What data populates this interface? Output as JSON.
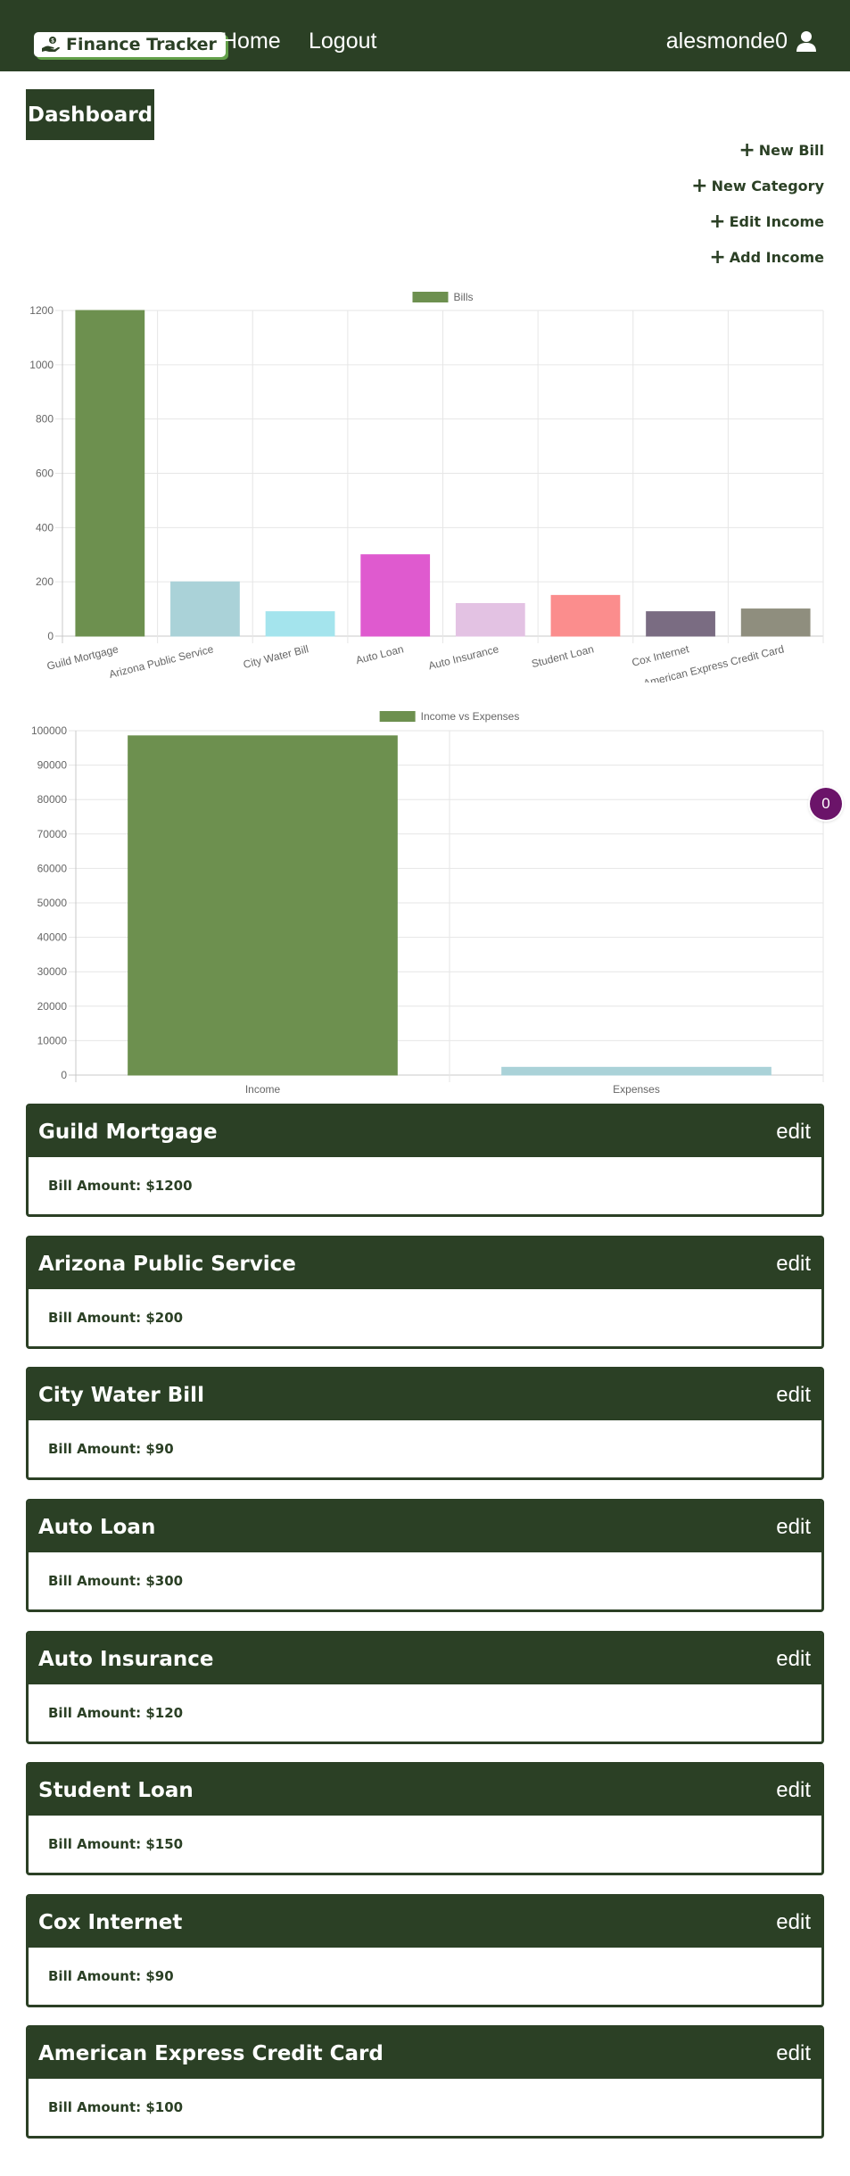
{
  "navbar": {
    "brand": "Finance Tracker",
    "brand_icon": "hand-holding-dollar-icon",
    "links": [
      "Home",
      "Logout"
    ],
    "username": "alesmonde0",
    "user_icon": "user-icon"
  },
  "page": {
    "title": "Dashboard"
  },
  "actions": [
    {
      "label": "New Bill",
      "icon": "plus-icon"
    },
    {
      "label": "New Category",
      "icon": "plus-icon"
    },
    {
      "label": "Edit Income",
      "icon": "plus-icon"
    },
    {
      "label": "Add Income",
      "icon": "plus-icon"
    }
  ],
  "notification_badge": "0",
  "chart_data": [
    {
      "type": "bar",
      "legend": "Bills",
      "categories": [
        "Guild Mortgage",
        "Arizona Public Service",
        "City Water Bill",
        "Auto Loan",
        "Auto Insurance",
        "Student Loan",
        "Cox Internet",
        "American Express Credit Card"
      ],
      "values": [
        1200,
        200,
        90,
        300,
        120,
        150,
        90,
        100
      ],
      "colors": [
        "#6d904f",
        "#aad2d8",
        "#a4e4ed",
        "#df5acf",
        "#e3c2e3",
        "#fb8d8d",
        "#7a6c82",
        "#8f8e7e"
      ],
      "ylim": [
        0,
        1200
      ],
      "yticks": [
        0,
        200,
        400,
        600,
        800,
        1000,
        1200
      ],
      "legend_color": "#6d904f",
      "legend_position": "top"
    },
    {
      "type": "bar",
      "legend": "Income vs Expenses",
      "categories": [
        "Income",
        "Expenses"
      ],
      "values": [
        98500,
        2250
      ],
      "colors": [
        "#6d904f",
        "#aad2d8"
      ],
      "ylim": [
        0,
        100000
      ],
      "yticks": [
        0,
        10000,
        20000,
        30000,
        40000,
        50000,
        60000,
        70000,
        80000,
        90000,
        100000
      ],
      "legend_color": "#6d904f",
      "legend_position": "top"
    }
  ],
  "bills": [
    {
      "name": "Guild Mortgage",
      "amount": "Bill Amount: $1200",
      "edit": "edit"
    },
    {
      "name": "Arizona Public Service",
      "amount": "Bill Amount: $200",
      "edit": "edit"
    },
    {
      "name": "City Water Bill",
      "amount": "Bill Amount: $90",
      "edit": "edit"
    },
    {
      "name": "Auto Loan",
      "amount": "Bill Amount: $300",
      "edit": "edit"
    },
    {
      "name": "Auto Insurance",
      "amount": "Bill Amount: $120",
      "edit": "edit"
    },
    {
      "name": "Student Loan",
      "amount": "Bill Amount: $150",
      "edit": "edit"
    },
    {
      "name": "Cox Internet",
      "amount": "Bill Amount: $90",
      "edit": "edit"
    },
    {
      "name": "American Express Credit Card",
      "amount": "Bill Amount: $100",
      "edit": "edit"
    }
  ],
  "colors": {
    "primary": "#2b4025",
    "accent": "#63a04a",
    "badge": "#6b1469"
  }
}
